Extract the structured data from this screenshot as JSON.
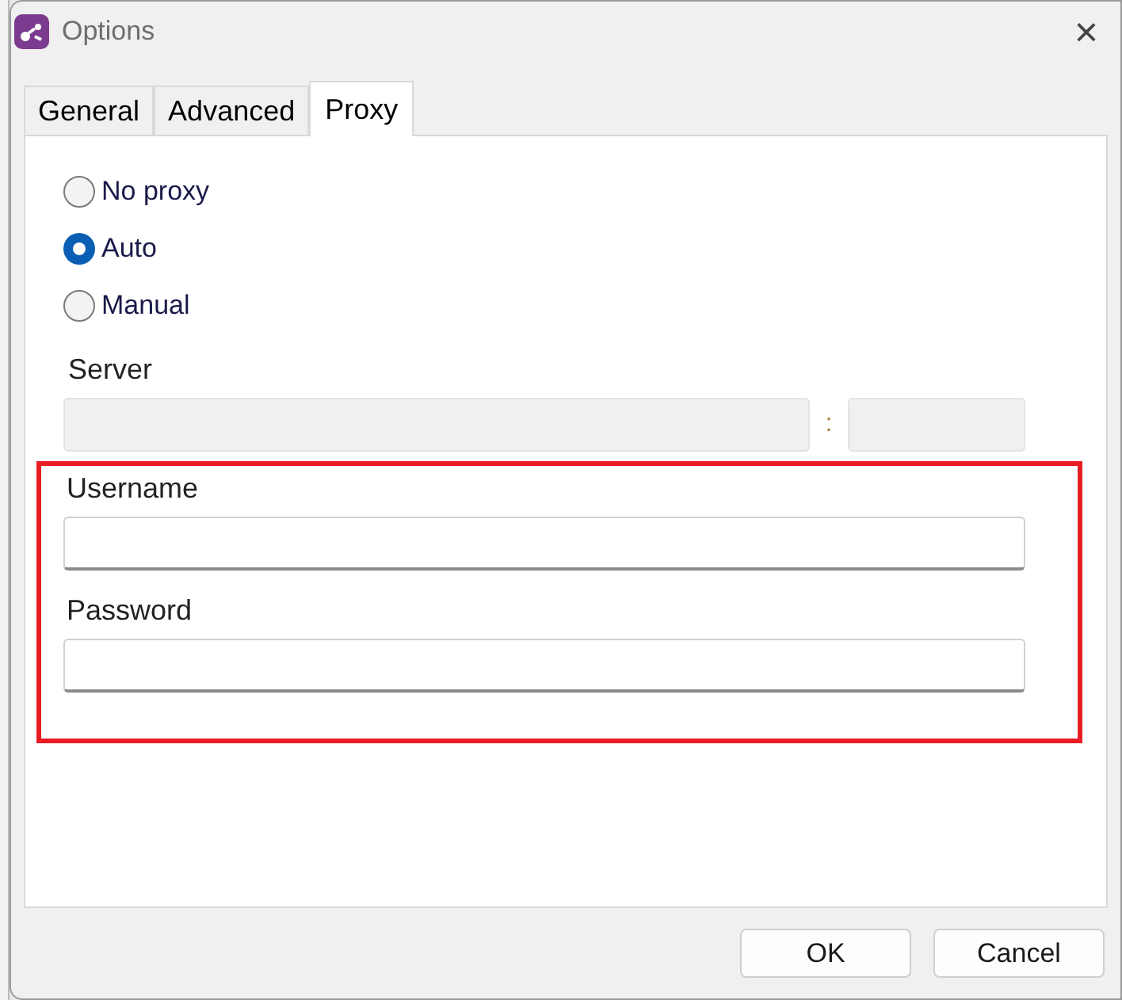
{
  "window": {
    "title": "Options",
    "close": "×"
  },
  "tabs": [
    {
      "label": "General",
      "selected": false
    },
    {
      "label": "Advanced",
      "selected": false
    },
    {
      "label": "Proxy",
      "selected": true
    }
  ],
  "proxy_modes": [
    {
      "label": "No proxy",
      "selected": false
    },
    {
      "label": "Auto",
      "selected": true
    },
    {
      "label": "Manual",
      "selected": false
    }
  ],
  "server": {
    "label": "Server",
    "separator": ":",
    "disabled": true
  },
  "username": {
    "label": "Username"
  },
  "password": {
    "label": "Password"
  },
  "buttons": [
    "OK",
    "Cancel"
  ]
}
